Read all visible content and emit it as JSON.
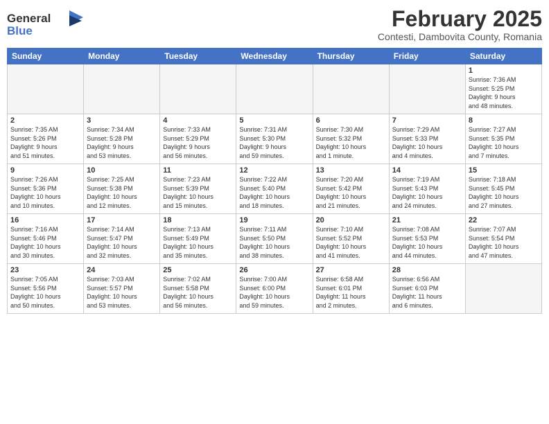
{
  "header": {
    "title": "February 2025",
    "location": "Contesti, Dambovita County, Romania",
    "logo_general": "General",
    "logo_blue": "Blue"
  },
  "days_of_week": [
    "Sunday",
    "Monday",
    "Tuesday",
    "Wednesday",
    "Thursday",
    "Friday",
    "Saturday"
  ],
  "weeks": [
    [
      {
        "num": "",
        "info": "",
        "empty": true
      },
      {
        "num": "",
        "info": "",
        "empty": true
      },
      {
        "num": "",
        "info": "",
        "empty": true
      },
      {
        "num": "",
        "info": "",
        "empty": true
      },
      {
        "num": "",
        "info": "",
        "empty": true
      },
      {
        "num": "",
        "info": "",
        "empty": true
      },
      {
        "num": "1",
        "info": "Sunrise: 7:36 AM\nSunset: 5:25 PM\nDaylight: 9 hours\nand 48 minutes.",
        "empty": false
      }
    ],
    [
      {
        "num": "2",
        "info": "Sunrise: 7:35 AM\nSunset: 5:26 PM\nDaylight: 9 hours\nand 51 minutes.",
        "empty": false
      },
      {
        "num": "3",
        "info": "Sunrise: 7:34 AM\nSunset: 5:28 PM\nDaylight: 9 hours\nand 53 minutes.",
        "empty": false
      },
      {
        "num": "4",
        "info": "Sunrise: 7:33 AM\nSunset: 5:29 PM\nDaylight: 9 hours\nand 56 minutes.",
        "empty": false
      },
      {
        "num": "5",
        "info": "Sunrise: 7:31 AM\nSunset: 5:30 PM\nDaylight: 9 hours\nand 59 minutes.",
        "empty": false
      },
      {
        "num": "6",
        "info": "Sunrise: 7:30 AM\nSunset: 5:32 PM\nDaylight: 10 hours\nand 1 minute.",
        "empty": false
      },
      {
        "num": "7",
        "info": "Sunrise: 7:29 AM\nSunset: 5:33 PM\nDaylight: 10 hours\nand 4 minutes.",
        "empty": false
      },
      {
        "num": "8",
        "info": "Sunrise: 7:27 AM\nSunset: 5:35 PM\nDaylight: 10 hours\nand 7 minutes.",
        "empty": false
      }
    ],
    [
      {
        "num": "9",
        "info": "Sunrise: 7:26 AM\nSunset: 5:36 PM\nDaylight: 10 hours\nand 10 minutes.",
        "empty": false
      },
      {
        "num": "10",
        "info": "Sunrise: 7:25 AM\nSunset: 5:38 PM\nDaylight: 10 hours\nand 12 minutes.",
        "empty": false
      },
      {
        "num": "11",
        "info": "Sunrise: 7:23 AM\nSunset: 5:39 PM\nDaylight: 10 hours\nand 15 minutes.",
        "empty": false
      },
      {
        "num": "12",
        "info": "Sunrise: 7:22 AM\nSunset: 5:40 PM\nDaylight: 10 hours\nand 18 minutes.",
        "empty": false
      },
      {
        "num": "13",
        "info": "Sunrise: 7:20 AM\nSunset: 5:42 PM\nDaylight: 10 hours\nand 21 minutes.",
        "empty": false
      },
      {
        "num": "14",
        "info": "Sunrise: 7:19 AM\nSunset: 5:43 PM\nDaylight: 10 hours\nand 24 minutes.",
        "empty": false
      },
      {
        "num": "15",
        "info": "Sunrise: 7:18 AM\nSunset: 5:45 PM\nDaylight: 10 hours\nand 27 minutes.",
        "empty": false
      }
    ],
    [
      {
        "num": "16",
        "info": "Sunrise: 7:16 AM\nSunset: 5:46 PM\nDaylight: 10 hours\nand 30 minutes.",
        "empty": false
      },
      {
        "num": "17",
        "info": "Sunrise: 7:14 AM\nSunset: 5:47 PM\nDaylight: 10 hours\nand 32 minutes.",
        "empty": false
      },
      {
        "num": "18",
        "info": "Sunrise: 7:13 AM\nSunset: 5:49 PM\nDaylight: 10 hours\nand 35 minutes.",
        "empty": false
      },
      {
        "num": "19",
        "info": "Sunrise: 7:11 AM\nSunset: 5:50 PM\nDaylight: 10 hours\nand 38 minutes.",
        "empty": false
      },
      {
        "num": "20",
        "info": "Sunrise: 7:10 AM\nSunset: 5:52 PM\nDaylight: 10 hours\nand 41 minutes.",
        "empty": false
      },
      {
        "num": "21",
        "info": "Sunrise: 7:08 AM\nSunset: 5:53 PM\nDaylight: 10 hours\nand 44 minutes.",
        "empty": false
      },
      {
        "num": "22",
        "info": "Sunrise: 7:07 AM\nSunset: 5:54 PM\nDaylight: 10 hours\nand 47 minutes.",
        "empty": false
      }
    ],
    [
      {
        "num": "23",
        "info": "Sunrise: 7:05 AM\nSunset: 5:56 PM\nDaylight: 10 hours\nand 50 minutes.",
        "empty": false
      },
      {
        "num": "24",
        "info": "Sunrise: 7:03 AM\nSunset: 5:57 PM\nDaylight: 10 hours\nand 53 minutes.",
        "empty": false
      },
      {
        "num": "25",
        "info": "Sunrise: 7:02 AM\nSunset: 5:58 PM\nDaylight: 10 hours\nand 56 minutes.",
        "empty": false
      },
      {
        "num": "26",
        "info": "Sunrise: 7:00 AM\nSunset: 6:00 PM\nDaylight: 10 hours\nand 59 minutes.",
        "empty": false
      },
      {
        "num": "27",
        "info": "Sunrise: 6:58 AM\nSunset: 6:01 PM\nDaylight: 11 hours\nand 2 minutes.",
        "empty": false
      },
      {
        "num": "28",
        "info": "Sunrise: 6:56 AM\nSunset: 6:03 PM\nDaylight: 11 hours\nand 6 minutes.",
        "empty": false
      },
      {
        "num": "",
        "info": "",
        "empty": true
      }
    ]
  ]
}
